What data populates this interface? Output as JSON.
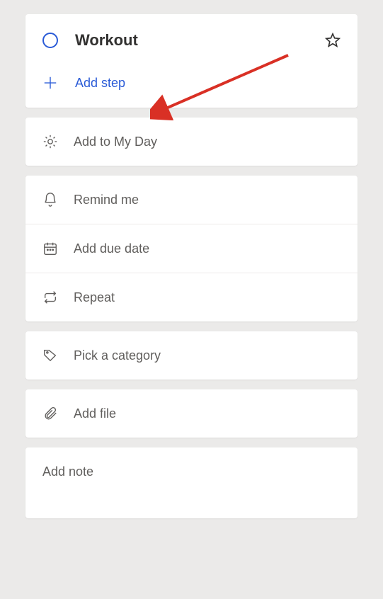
{
  "task": {
    "title": "Workout",
    "addStepLabel": "Add step"
  },
  "options": {
    "addToMyDay": "Add to My Day",
    "remindMe": "Remind me",
    "addDueDate": "Add due date",
    "repeat": "Repeat",
    "pickCategory": "Pick a category",
    "addFile": "Add file"
  },
  "note": {
    "placeholder": "Add note"
  }
}
